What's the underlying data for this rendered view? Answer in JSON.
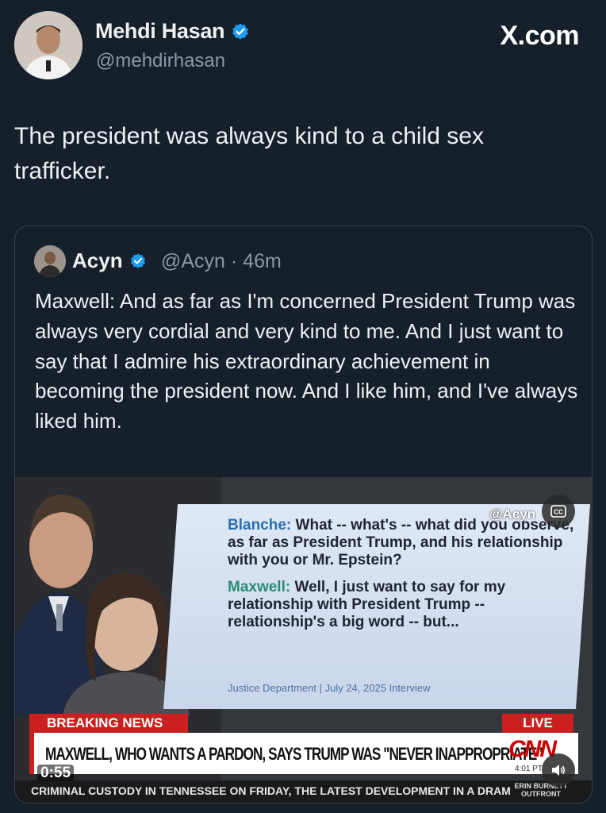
{
  "author": {
    "name": "Mehdi Hasan",
    "handle": "@mehdirhasan",
    "verified_icon": "verified-badge-icon"
  },
  "brand": {
    "label": "X.com"
  },
  "tweet": {
    "text": "The president was always kind to a child sex trafficker."
  },
  "quoted_tweet": {
    "name": "Acyn",
    "handle": "@Acyn · 46m",
    "text": "Maxwell: And as far as I'm concerned President Trump was always very cordial and very kind to me. And I just want to say that I admire his extraordinary achievement in becoming the president now. And I like him, and I've always liked him."
  },
  "video": {
    "watermark": "@Acyn",
    "panel": {
      "speaker1": "Blanche:",
      "line1": "What -- what's -- what did you observe, as far as President Trump, and his relationship with you or Mr. Epstein?",
      "speaker2": "Maxwell:",
      "line2": "Well, I just want to say for my relationship with President Trump -- relationship's a big word -- but...",
      "source": "Justice Department | July 24, 2025 Interview"
    },
    "breaking_label": "BREAKING NEWS",
    "live_label": "LIVE",
    "headline": "MAXWELL, WHO WANTS A PARDON, SAYS TRUMP WAS \"NEVER INAPPROPRIATE\"",
    "network_logo": "CNN",
    "clock": "4:01 PT",
    "elapsed": "0:55",
    "ticker": "CRIMINAL CUSTODY IN TENNESSEE ON FRIDAY, THE LATEST DEVELOPMENT IN A DRAM",
    "show_name": "ERIN BURNETT OUTFRONT"
  },
  "colors": {
    "background": "#15202b",
    "verified": "#1d9bf0",
    "cnn_red": "#cc1f1f"
  }
}
